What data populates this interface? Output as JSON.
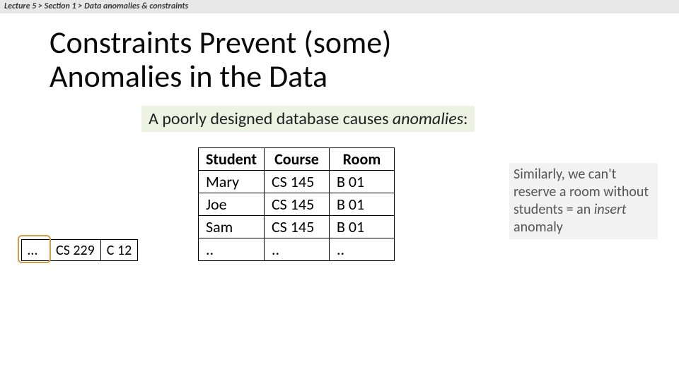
{
  "breadcrumb": {
    "lecture": "Lecture 5",
    "section": "Section 1",
    "topic": "Data anomalies & constraints",
    "sep": " > "
  },
  "title_line1": "Constraints Prevent (some)",
  "title_line2": "Anomalies in the Data",
  "subtitle_prefix": "A poorly designed database causes ",
  "subtitle_em": "anomalies",
  "subtitle_suffix": ":",
  "table": {
    "headers": [
      "Student",
      "Course",
      "Room"
    ],
    "rows": [
      [
        "Mary",
        "CS 145",
        "B 01"
      ],
      [
        "Joe",
        "CS 145",
        "B 01"
      ],
      [
        "Sam",
        "CS 145",
        "B 01"
      ],
      [
        "..",
        "..",
        ".."
      ]
    ]
  },
  "mini_row": [
    "…",
    "CS 229",
    "C 12"
  ],
  "note_text": "Similarly, we can't reserve a room without students = an ",
  "note_em": "insert ",
  "note_tail": "anomaly"
}
